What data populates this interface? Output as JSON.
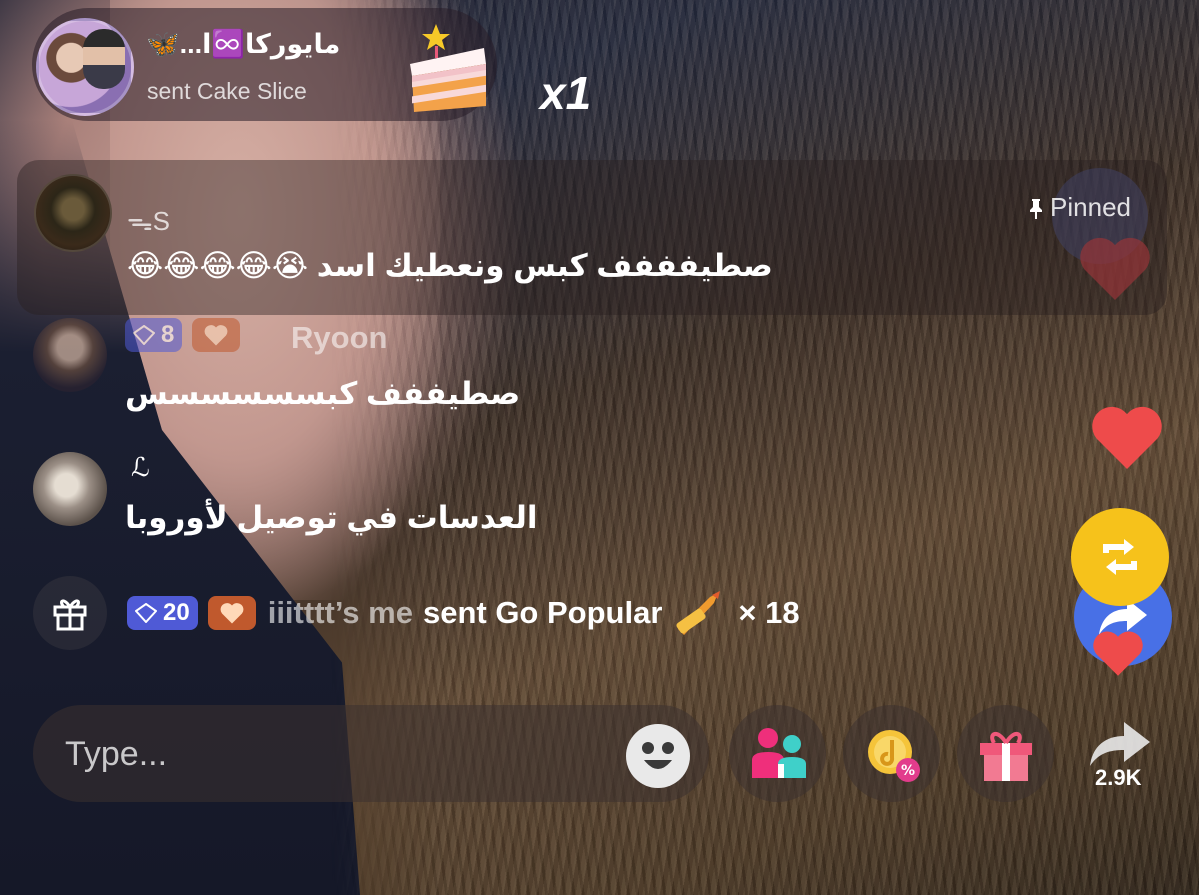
{
  "gift_banner": {
    "sender": "مايوركا♾️ا...🦋",
    "action": "sent Cake Slice",
    "combo": "x1"
  },
  "pinned": {
    "username": "ᯓS",
    "tag": "Pinned",
    "message": "صطيفففف كبس ونعطيك اسد 😭😂😂😂😂"
  },
  "comments": [
    {
      "level": "8",
      "username": "Ryoon",
      "message": "صطيففف كبسسسسسس"
    },
    {
      "username": "ℒ",
      "message": "العدسات في توصيل لأوروبا"
    }
  ],
  "gift_event": {
    "level": "20",
    "sender": "iiitttt’s me",
    "action": "sent Go Popular",
    "count": "× 18"
  },
  "input": {
    "placeholder": "Type..."
  },
  "actions": {
    "share_count": "2.9K"
  },
  "colors": {
    "level_badge": "#4f5ad6",
    "fan_badge": "#c0592d",
    "repost": "#f6c21b",
    "share": "#4870e6",
    "heart": "#ee4b4b"
  },
  "icons": [
    "cake-slice-icon",
    "pin-icon",
    "gift-icon",
    "diamond-level-icon",
    "fan-heart-icon",
    "go-popular-rocket-icon",
    "heart-icon",
    "repost-icon",
    "share-icon",
    "emoji-icon",
    "people-icon",
    "coin-discount-icon",
    "gift-box-icon"
  ]
}
